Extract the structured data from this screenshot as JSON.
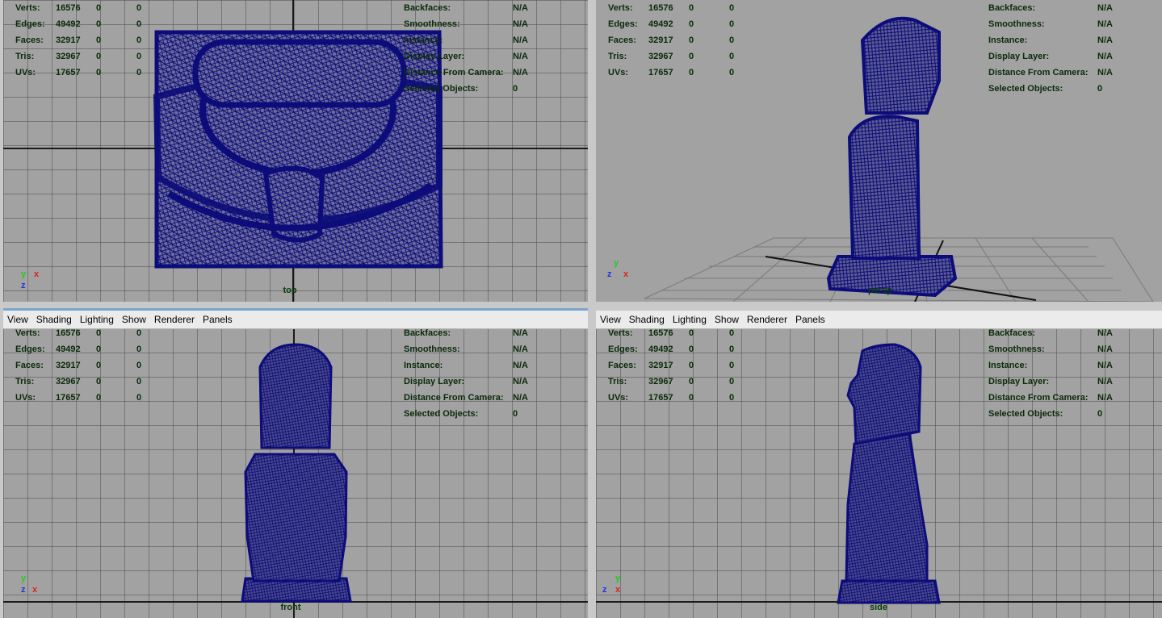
{
  "menu": [
    "View",
    "Shading",
    "Lighting",
    "Show",
    "Renderer",
    "Panels"
  ],
  "stats_left": [
    {
      "label": "Verts:",
      "v1": "16576",
      "v2": "0",
      "v3": "0"
    },
    {
      "label": "Edges:",
      "v1": "49492",
      "v2": "0",
      "v3": "0"
    },
    {
      "label": "Faces:",
      "v1": "32917",
      "v2": "0",
      "v3": "0"
    },
    {
      "label": "Tris:",
      "v1": "32967",
      "v2": "0",
      "v3": "0"
    },
    {
      "label": "UVs:",
      "v1": "17657",
      "v2": "0",
      "v3": "0"
    }
  ],
  "stats_right": [
    {
      "label": "Backfaces:",
      "value": "N/A"
    },
    {
      "label": "Smoothness:",
      "value": "N/A"
    },
    {
      "label": "Instance:",
      "value": "N/A"
    },
    {
      "label": "Display Layer:",
      "value": "N/A"
    },
    {
      "label": "Distance From Camera:",
      "value": "N/A"
    },
    {
      "label": "Selected Objects:",
      "value": "0"
    }
  ],
  "cameras": {
    "top": "top",
    "persp": "persp",
    "front": "front",
    "side": "side"
  },
  "gizmo": {
    "x": "x",
    "y": "y",
    "z": "z"
  },
  "colors": {
    "viewport_bg": "#a2a2a2",
    "wireframe": "#0c0c7a",
    "hud_text": "#0a2a0a"
  }
}
